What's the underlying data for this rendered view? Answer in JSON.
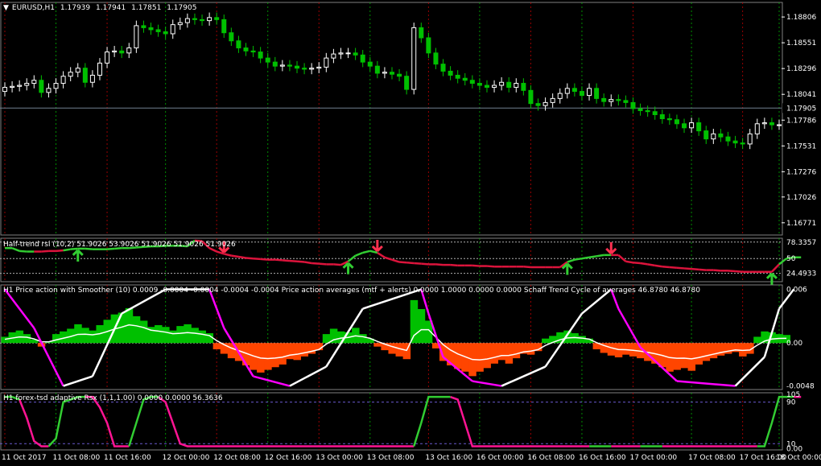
{
  "main": {
    "symbol": "EURUSD,H1",
    "ohlc": [
      "1.17939",
      "1.17941",
      "1.17851",
      "1.17905"
    ],
    "price_labels": [
      "1.18806",
      "1.18551",
      "1.18296",
      "1.18041",
      "1.17786",
      "1.17531",
      "1.17276",
      "1.17026",
      "1.16771"
    ],
    "current_price": "1.17905"
  },
  "panel1": {
    "title": "Half-trend rsi (10,2) 51.9026 53.9026 51.9026 51.9026 51.9026",
    "labels": [
      "78.3357",
      "50",
      "24.4933"
    ]
  },
  "panel2": {
    "title": "H1 Price action with Smoother (10) 0.0009 -0.0004 -0.0004 -0.0004 -0.0004  Price action averages (mtf + alerts) 0.0000 1.0000 0.0000 0.0000  Schaff Trend Cycle of averages 46.8780 46.8780",
    "labels": [
      "0.006",
      "0.00",
      "-0.0048"
    ]
  },
  "panel3": {
    "title": "H1 forex-tsd adaptive Rsx (1,1,1.00) 0.0000 0.0000 56.3636",
    "labels": [
      "105",
      "90",
      "10",
      "0.00"
    ]
  },
  "time_labels": [
    "11 Oct 2017",
    "11 Oct 08:00",
    "11 Oct 16:00",
    "12 Oct 00:00",
    "12 Oct 08:00",
    "12 Oct 16:00",
    "13 Oct 00:00",
    "13 Oct 08:00",
    "13 Oct 16:00",
    "16 Oct 00:00",
    "16 Oct 08:00",
    "16 Oct 16:00",
    "17 Oct 00:00",
    "17 Oct 08:00",
    "17 Oct 16:00",
    "18 Oct 00:00"
  ],
  "colors": {
    "bull": "#ffffff",
    "bear": "#00c000",
    "grid": "#404040",
    "up_line": "#00b000",
    "down_line": "#c00000",
    "green": "#00c000",
    "red": "#e00000",
    "orange": "#ff4500",
    "magenta": "#ff00ff",
    "pink": "#ff1493",
    "lime": "#32cd32"
  },
  "chart_data": [
    {
      "type": "candlestick",
      "series": "EURUSD,H1",
      "ylim": [
        1.1665,
        1.1895
      ],
      "close": [
        1.1811,
        1.1812,
        1.1813,
        1.1815,
        1.1818,
        1.1806,
        1.181,
        1.1815,
        1.1822,
        1.1826,
        1.183,
        1.1816,
        1.1823,
        1.1835,
        1.1846,
        1.1847,
        1.1845,
        1.185,
        1.1872,
        1.187,
        1.1868,
        1.1866,
        1.1864,
        1.1873,
        1.1875,
        1.1879,
        1.1878,
        1.1877,
        1.188,
        1.1878,
        1.1865,
        1.1857,
        1.185,
        1.1847,
        1.1846,
        1.184,
        1.1836,
        1.1832,
        1.1833,
        1.1832,
        1.183,
        1.1829,
        1.183,
        1.1831,
        1.184,
        1.1844,
        1.1845,
        1.1845,
        1.1843,
        1.1836,
        1.1832,
        1.1825,
        1.1826,
        1.1824,
        1.1822,
        1.1809,
        1.187,
        1.186,
        1.1845,
        1.1834,
        1.1827,
        1.1823,
        1.182,
        1.1818,
        1.1815,
        1.1813,
        1.1811,
        1.1813,
        1.1816,
        1.1811,
        1.1815,
        1.1808,
        1.1795,
        1.1793,
        1.1796,
        1.18,
        1.1805,
        1.181,
        1.1807,
        1.1803,
        1.181,
        1.18,
        1.1797,
        1.1799,
        1.1798,
        1.1796,
        1.179,
        1.1788,
        1.1787,
        1.1784,
        1.178,
        1.1779,
        1.1775,
        1.1771,
        1.1776,
        1.1768,
        1.176,
        1.1765,
        1.1762,
        1.1758,
        1.1756,
        1.1755,
        1.1765,
        1.1775,
        1.1776,
        1.1774,
        1.1774
      ]
    },
    {
      "type": "line",
      "series": "Half-trend rsi",
      "ylim": [
        10,
        85
      ],
      "values": [
        68,
        68,
        63,
        62,
        62,
        62,
        63,
        63,
        64,
        66,
        67,
        67,
        66,
        66,
        66,
        67,
        68,
        68,
        69,
        70,
        71,
        71,
        72,
        72,
        72,
        71,
        81,
        80,
        68,
        62,
        58,
        55,
        53,
        51,
        50,
        49,
        48,
        48,
        47,
        46,
        45,
        44,
        42,
        41,
        40,
        40,
        39,
        45,
        55,
        60,
        63,
        60,
        52,
        48,
        44,
        43,
        42,
        41,
        40,
        40,
        39,
        39,
        38,
        38,
        38,
        37,
        37,
        36,
        36,
        36,
        36,
        36,
        35,
        35,
        35,
        35,
        35,
        44,
        48,
        50,
        52,
        54,
        56,
        56,
        56,
        45,
        43,
        42,
        40,
        38,
        36,
        35,
        34,
        33,
        32,
        31,
        30,
        30,
        29,
        29,
        28,
        27,
        27,
        27,
        27,
        27,
        40,
        50,
        52,
        52
      ],
      "trend": [
        1,
        1,
        1,
        1,
        -1,
        -1,
        -1,
        -1,
        1,
        1,
        1,
        1,
        1,
        1,
        1,
        1,
        1,
        1,
        1,
        1,
        1,
        1,
        1,
        1,
        1,
        1,
        -1,
        -1,
        -1,
        -1,
        -1,
        -1,
        -1,
        -1,
        -1,
        -1,
        -1,
        -1,
        -1,
        -1,
        -1,
        -1,
        -1,
        -1,
        -1,
        -1,
        -1,
        1,
        1,
        1,
        1,
        -1,
        -1,
        -1,
        -1,
        -1,
        -1,
        -1,
        -1,
        -1,
        -1,
        -1,
        -1,
        -1,
        -1,
        -1,
        -1,
        -1,
        -1,
        -1,
        -1,
        -1,
        -1,
        -1,
        -1,
        -1,
        -1,
        1,
        1,
        1,
        1,
        1,
        1,
        -1,
        -1,
        -1,
        -1,
        -1,
        -1,
        -1,
        -1,
        -1,
        -1,
        -1,
        -1,
        -1,
        -1,
        -1,
        -1,
        -1,
        -1,
        -1,
        -1,
        -1,
        -1,
        -1,
        1,
        1,
        1,
        1
      ],
      "arrows_up": [
        10,
        47,
        77,
        105
      ],
      "arrows_down": [
        30,
        51,
        83
      ]
    },
    {
      "type": "histogram",
      "series": "Price action with Smoother",
      "ylim": [
        -0.0052,
        0.0065
      ],
      "values": [
        0.0007,
        0.0012,
        0.0014,
        0.001,
        0.0004,
        -0.0004,
        0.0002,
        0.001,
        0.0013,
        0.0016,
        0.0021,
        0.0017,
        0.0014,
        0.002,
        0.0026,
        0.0032,
        0.0034,
        0.0039,
        0.003,
        0.0025,
        0.0018,
        0.002,
        0.0018,
        0.0014,
        0.0019,
        0.0021,
        0.0017,
        0.0014,
        0.0011,
        -0.0007,
        -0.0012,
        -0.0017,
        -0.002,
        -0.0025,
        -0.003,
        -0.0033,
        -0.003,
        -0.0027,
        -0.0024,
        -0.0018,
        -0.0019,
        -0.0015,
        -0.0012,
        -0.0008,
        0.001,
        0.0016,
        0.0013,
        0.0012,
        0.0017,
        0.001,
        0.0005,
        -0.0004,
        -0.0008,
        -0.0012,
        -0.0015,
        -0.0018,
        0.0048,
        0.0038,
        0.0025,
        -0.0006,
        -0.002,
        -0.0025,
        -0.0029,
        -0.0032,
        -0.0037,
        -0.0032,
        -0.0028,
        -0.0023,
        -0.0019,
        -0.0023,
        -0.0017,
        -0.0012,
        -0.0013,
        -0.0009,
        0.0005,
        0.0008,
        0.0012,
        0.0014,
        0.0011,
        0.0008,
        0.0005,
        -0.0007,
        -0.0011,
        -0.0014,
        -0.0016,
        -0.0013,
        -0.0015,
        -0.0017,
        -0.002,
        -0.0023,
        -0.0027,
        -0.0032,
        -0.003,
        -0.0028,
        -0.0031,
        -0.0024,
        -0.002,
        -0.0017,
        -0.0014,
        -0.0012,
        -0.001,
        -0.0015,
        -0.0012,
        0.0007,
        0.0013,
        0.0012,
        0.001,
        0.0009
      ],
      "schaff_pieces": [
        [
          0,
          100
        ],
        [
          4,
          60
        ],
        [
          6,
          30
        ],
        [
          8,
          0
        ],
        [
          12,
          10
        ],
        [
          16,
          75
        ],
        [
          22,
          100
        ],
        [
          28,
          100
        ],
        [
          30,
          60
        ],
        [
          34,
          10
        ],
        [
          39,
          0
        ],
        [
          44,
          20
        ],
        [
          49,
          80
        ],
        [
          55,
          95
        ],
        [
          57,
          100
        ],
        [
          58,
          75
        ],
        [
          60,
          30
        ],
        [
          64,
          5
        ],
        [
          68,
          0
        ],
        [
          74,
          20
        ],
        [
          79,
          75
        ],
        [
          83,
          100
        ],
        [
          84,
          80
        ],
        [
          87,
          40
        ],
        [
          92,
          5
        ],
        [
          100,
          0
        ],
        [
          104,
          30
        ],
        [
          106,
          80
        ],
        [
          108,
          100
        ]
      ]
    },
    {
      "type": "line",
      "series": "forex-tsd adaptive Rsx",
      "ylim": [
        -2,
        108
      ],
      "values": [
        100,
        100,
        95,
        60,
        15,
        5,
        5,
        20,
        90,
        95,
        100,
        100,
        100,
        80,
        50,
        5,
        5,
        5,
        50,
        95,
        100,
        100,
        90,
        50,
        10,
        5,
        5,
        5,
        5,
        5,
        5,
        5,
        5,
        5,
        5,
        5,
        5,
        5,
        5,
        5,
        5,
        5,
        5,
        5,
        5,
        5,
        5,
        5,
        5,
        5,
        5,
        5,
        5,
        5,
        5,
        5,
        5,
        50,
        100,
        100,
        100,
        100,
        95,
        50,
        5,
        5,
        5,
        5,
        5,
        5,
        5,
        5,
        5,
        5,
        5,
        5,
        5,
        5,
        5,
        5,
        5,
        5,
        5,
        5,
        5,
        5,
        5,
        5,
        5,
        5,
        5,
        5,
        5,
        5,
        5,
        5,
        5,
        5,
        5,
        5,
        5,
        5,
        5,
        5,
        5,
        50,
        100,
        100,
        100,
        100,
        100,
        5
      ],
      "up_segments": [
        [
          0,
          2
        ],
        [
          6,
          11
        ],
        [
          17,
          21
        ],
        [
          56,
          61
        ],
        [
          80,
          83
        ],
        [
          87,
          90
        ],
        [
          103,
          108
        ]
      ],
      "down_segments": [
        [
          2,
          6
        ],
        [
          11,
          17
        ],
        [
          21,
          56
        ],
        [
          61,
          80
        ],
        [
          83,
          87
        ],
        [
          90,
          103
        ],
        [
          108,
          109
        ]
      ]
    }
  ]
}
